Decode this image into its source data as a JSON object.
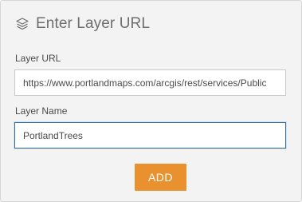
{
  "dialog": {
    "icon": "layers-icon",
    "title": "Enter Layer URL"
  },
  "layer_url": {
    "label": "Layer URL",
    "value": "https://www.portlandmaps.com/arcgis/rest/services/Public"
  },
  "layer_name": {
    "label": "Layer Name",
    "value": "PortlandTrees"
  },
  "actions": {
    "add_label": "ADD",
    "add_color": "#e8912e"
  },
  "colors": {
    "panel_bg": "#f3f3f3",
    "focus_border": "#2f6fa3"
  }
}
